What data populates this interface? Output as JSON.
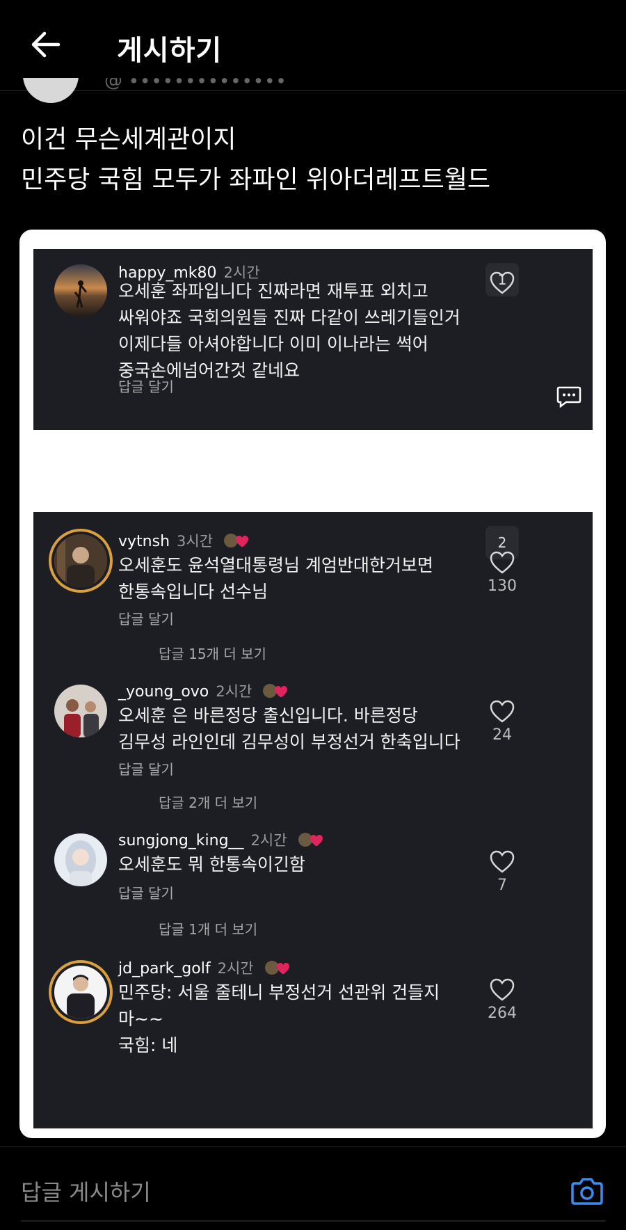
{
  "header": {
    "title": "게시하기"
  },
  "post": {
    "lines": [
      "이건 무슨세계관이지",
      "민주당 국힘 모두가 좌파인 위아더레프트월드"
    ]
  },
  "screenshot1": {
    "comment": {
      "username": "happy_mk80",
      "time": "2시간",
      "lines": [
        "오세훈 좌파입니다 진짜라면 재투표 외치고",
        "싸워야죠 국회의원들 진짜 다같이 쓰레기들인거",
        "이제다들 아셔야합니다 이미 이나라는 썩어",
        "중국손에넘어간것 같네요"
      ],
      "reply_label": "답글 달기",
      "index": "1"
    }
  },
  "screenshot2": {
    "index": "2",
    "comments": [
      {
        "username": "vytnsh",
        "time": "3시간",
        "lines": [
          "오세훈도 윤석열대통령님 계엄반대한거보면",
          "한통속입니다 선수님"
        ],
        "reply_label": "답글 달기",
        "likes": "130",
        "more": "답글 15개 더 보기"
      },
      {
        "username": "_young_ovo",
        "time": "2시간",
        "lines": [
          "오세훈 은 바른정당 출신입니다. 바른정당",
          "김무성 라인인데 김무성이 부정선거 한축입니다"
        ],
        "reply_label": "답글 달기",
        "likes": "24",
        "more": "답글 2개 더 보기"
      },
      {
        "username": "sungjong_king__",
        "time": "2시간",
        "lines": [
          "오세훈도 뭐 한통속이긴함"
        ],
        "reply_label": "답글 달기",
        "likes": "7",
        "more": "답글 1개 더 보기"
      },
      {
        "username": "jd_park_golf",
        "time": "2시간",
        "lines": [
          "민주당: 서울 줄테니 부정선거 선관위 건들지",
          "마~~",
          "국힘: 네"
        ],
        "likes": "264"
      }
    ]
  },
  "footer": {
    "placeholder": "답글 게시하기"
  },
  "colors": {
    "background": "#000000",
    "card": "#1d1e23",
    "accent": "#3b8cf0",
    "heart_badge": "#e0245e"
  }
}
